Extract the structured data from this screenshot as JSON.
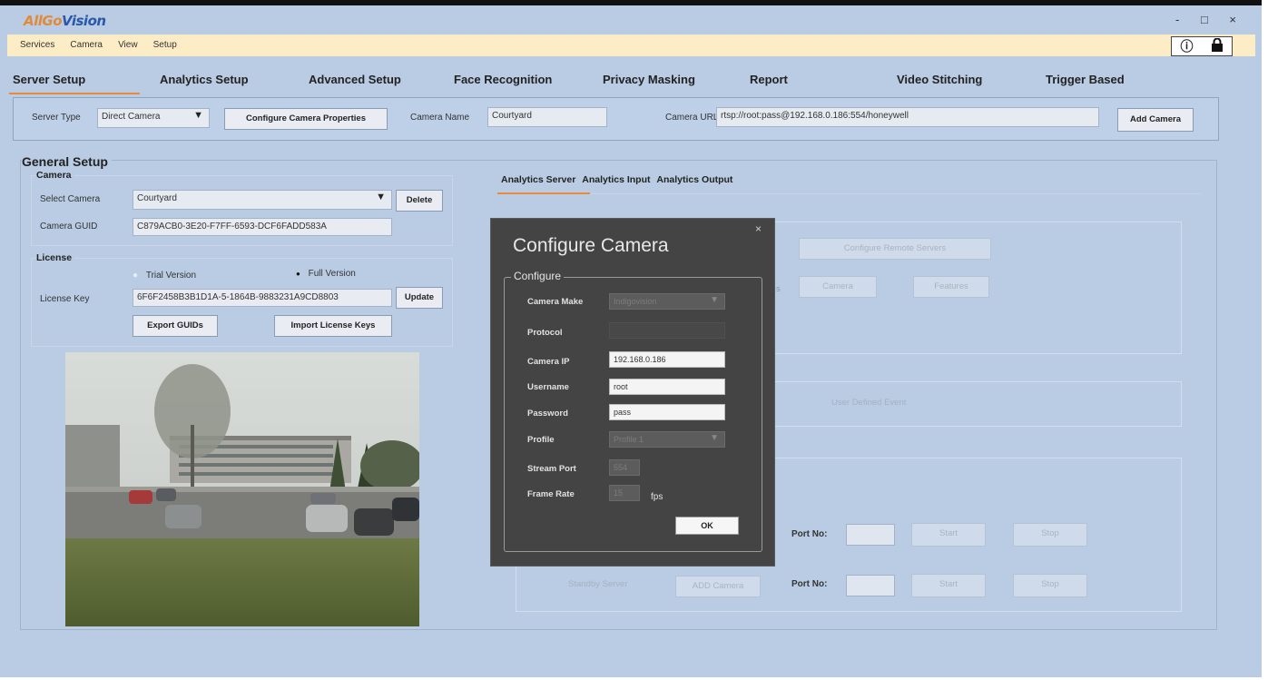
{
  "app": {
    "logo_part1": "AllGo",
    "logo_part2": "Vision",
    "window_controls": "- □ ×"
  },
  "menu": [
    "Services",
    "Camera",
    "View",
    "Setup"
  ],
  "tabs": [
    "Server Setup",
    "Analytics Setup",
    "Advanced Setup",
    "Face Recognition",
    "Privacy Masking",
    "Report",
    "Video Stitching",
    "Trigger Based"
  ],
  "server_bar": {
    "server_type_label": "Server Type",
    "server_type_value": "Direct Camera",
    "configure_button": "Configure Camera Properties",
    "camera_name_label": "Camera Name",
    "camera_name_value": "Courtyard",
    "camera_url_label": "Camera URL",
    "camera_url_value": "rtsp://root:pass@192.168.0.186:554/honeywell",
    "add_camera_button": "Add Camera"
  },
  "general": {
    "title": "General Setup",
    "camera_group": "Camera",
    "select_camera_label": "Select Camera",
    "select_camera_value": "Courtyard",
    "delete_button": "Delete",
    "guid_label": "Camera GUID",
    "guid_value": "C879ACB0-3E20-F7FF-6593-DCF6FADD583A",
    "license_group": "License",
    "trial_label": "Trial Version",
    "full_label": "Full Version",
    "license_key_label": "License Key",
    "license_key_value": "6F6F2458B3B1D1A-5-1864B-9883231A9CD8803",
    "update_button": "Update",
    "export_button": "Export GUIDs",
    "import_button": "Import License Keys"
  },
  "right": {
    "subtabs": [
      "Analytics Server",
      "Analytics Input",
      "Analytics Output"
    ],
    "configure_remote_servers": "Configure Remote Servers",
    "camera_btn": "Camera",
    "features_btn": "Features",
    "user_defined_event": "User Defined Event",
    "port_label1": "Port No:",
    "start1": "Start",
    "stop1": "Stop",
    "standby_server": "Standby Server",
    "add_camera2": "ADD Camera",
    "port_label2": "Port No:",
    "start2": "Start",
    "stop2": "Stop"
  },
  "dialog": {
    "title": "Configure Camera",
    "close": "×",
    "group_title": "Configure",
    "camera_make_label": "Camera Make",
    "camera_make_value": "Indigovision",
    "protocol_label": "Protocol",
    "camera_ip_label": "Camera IP",
    "camera_ip_value": "192.168.0.186",
    "username_label": "Username",
    "username_value": "root",
    "password_label": "Password",
    "password_value": "pass",
    "profile_label": "Profile",
    "profile_value": "Profile 1",
    "stream_port_label": "Stream Port",
    "stream_port_value": "554",
    "frame_rate_label": "Frame Rate",
    "frame_rate_value": "15",
    "fps_label": "fps",
    "ok_button": "OK"
  }
}
